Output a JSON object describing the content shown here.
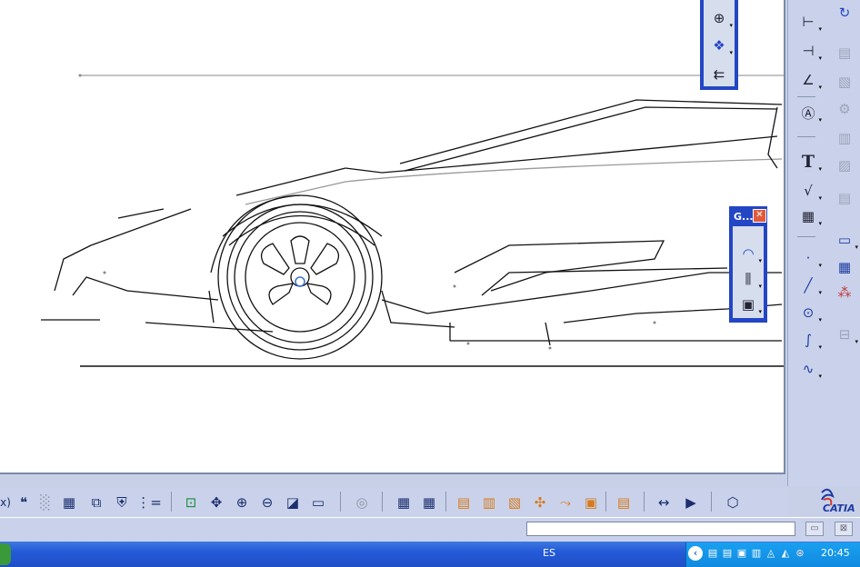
{
  "canvas": {
    "background": "#ffffff",
    "line_color": "#111111"
  },
  "right_toolbar": {
    "col1": [
      "dimension-icon",
      "dimension-properties-icon",
      "angle-dimension-icon",
      "text-icon",
      "text-T-icon",
      "roughness-icon",
      "table-icon",
      "point-icon",
      "line-icon",
      "circle-icon",
      "spline-icon",
      "curve-icon"
    ],
    "col2": [
      "rotate-view-icon",
      "grayed-icon-1",
      "grayed-icon-2",
      "grayed-icon-3",
      "grayed-icon-4",
      "grayed-icon-5",
      "grayed-icon-6",
      "rectangle-icon",
      "grid-icon",
      "pattern-icon",
      "axis-icon"
    ]
  },
  "analysis_toolbar": {
    "items": [
      "target-icon",
      "paint-icon",
      "arrow-left-icon"
    ]
  },
  "geometry_toolbar": {
    "title": "G...",
    "close": "✕",
    "items": [
      "arc-icon",
      "mirror-icon",
      "frame-icon"
    ]
  },
  "bottom_toolbar": {
    "labels": [
      "x)",
      "❝",
      "░",
      "▦",
      "⧉",
      "⛨",
      "⋮=",
      "⊡",
      "✥",
      "⊕",
      "⊖",
      "◪",
      "▭",
      "◎",
      "▦",
      "▦",
      "▤",
      "▥",
      "▧",
      "✣",
      "⤳",
      "▣",
      "▤",
      "↔",
      "▶",
      "⬡"
    ]
  },
  "catia": {
    "logo_text": "CATIA",
    "accent": "#1d3ba3"
  },
  "status_bar": {
    "command_value": "",
    "btn1": "▭",
    "btn2": "⊠"
  },
  "taskbar": {
    "language": "ES",
    "clock": "20:45"
  }
}
